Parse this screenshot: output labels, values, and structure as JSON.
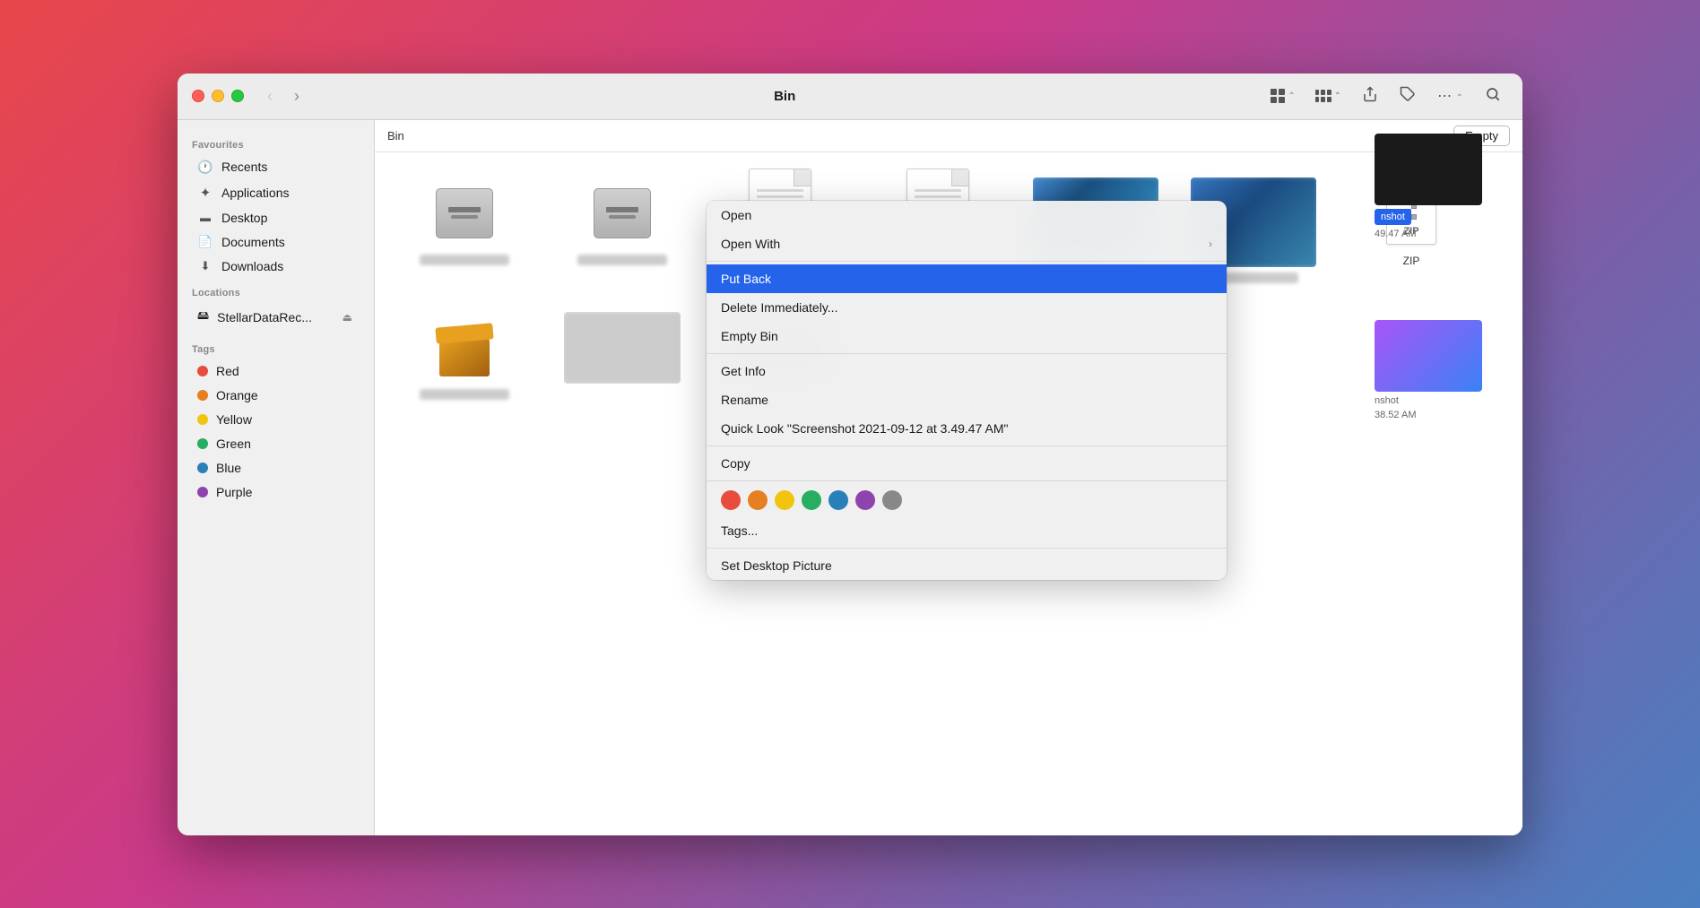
{
  "window": {
    "title": "Bin"
  },
  "titlebar": {
    "back_label": "‹",
    "forward_label": "›",
    "title": "Bin",
    "view_icon": "grid-view-icon",
    "view2_icon": "gallery-view-icon",
    "share_icon": "share-icon",
    "tag_icon": "tag-icon",
    "more_icon": "more-icon",
    "search_icon": "search-icon"
  },
  "breadcrumb": {
    "path": "Bin",
    "empty_button": "Empty"
  },
  "sidebar": {
    "favourites_label": "Favourites",
    "items": [
      {
        "id": "recents",
        "label": "Recents",
        "icon": "🕐"
      },
      {
        "id": "applications",
        "label": "Applications",
        "icon": "✦"
      },
      {
        "id": "desktop",
        "label": "Desktop",
        "icon": "▭"
      },
      {
        "id": "documents",
        "label": "Documents",
        "icon": "📄"
      },
      {
        "id": "downloads",
        "label": "Downloads",
        "icon": "⬇"
      }
    ],
    "locations_label": "Locations",
    "drives": [
      {
        "id": "stellar",
        "label": "StellarDataRec...",
        "icon": "⬛"
      }
    ],
    "tags_label": "Tags",
    "tags": [
      {
        "id": "red",
        "label": "Red",
        "color": "#e74c3c"
      },
      {
        "id": "orange",
        "label": "Orange",
        "color": "#e67e22"
      },
      {
        "id": "yellow",
        "label": "Yellow",
        "color": "#f1c40f"
      },
      {
        "id": "green",
        "label": "Green",
        "color": "#27ae60"
      },
      {
        "id": "blue",
        "label": "Blue",
        "color": "#2980b9"
      },
      {
        "id": "purple",
        "label": "Purple",
        "color": "#8e44ad"
      }
    ]
  },
  "context_menu": {
    "items": [
      {
        "id": "open",
        "label": "Open",
        "has_arrow": false
      },
      {
        "id": "open-with",
        "label": "Open With",
        "has_arrow": true
      },
      {
        "id": "put-back",
        "label": "Put Back",
        "highlighted": true,
        "has_arrow": false
      },
      {
        "id": "delete-immediately",
        "label": "Delete Immediately...",
        "has_arrow": false
      },
      {
        "id": "empty-bin",
        "label": "Empty Bin",
        "has_arrow": false
      },
      {
        "id": "get-info",
        "label": "Get Info",
        "has_arrow": false
      },
      {
        "id": "rename",
        "label": "Rename",
        "has_arrow": false
      },
      {
        "id": "quick-look",
        "label": "Quick Look \"Screenshot 2021-09-12 at 3.49.47 AM\"",
        "has_arrow": false
      },
      {
        "id": "copy",
        "label": "Copy",
        "has_arrow": false
      },
      {
        "id": "tags",
        "label": "Tags...",
        "has_arrow": false
      },
      {
        "id": "set-desktop",
        "label": "Set Desktop Picture",
        "has_arrow": false
      }
    ],
    "tag_colors": [
      "#e74c3c",
      "#e67e22",
      "#f1c40f",
      "#27ae60",
      "#2980b9",
      "#8e44ad",
      "#888888"
    ]
  },
  "right_panel": {
    "screenshot_label": "nshot",
    "screenshot_time1": "49.47 AM",
    "screenshot_time2": "38.52 AM",
    "screenshot_label2": "nshot"
  }
}
